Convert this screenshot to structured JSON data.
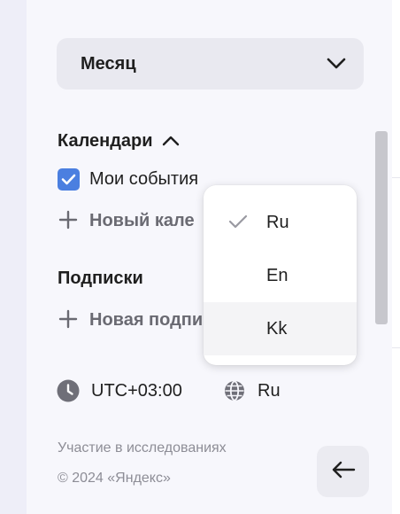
{
  "view_selector": {
    "selected": "Месяц"
  },
  "calendars": {
    "title": "Календари",
    "items": [
      {
        "label": "Мои события",
        "checked": true
      }
    ],
    "new_label": "Новый кале"
  },
  "subscriptions": {
    "title": "Подписки",
    "new_label": "Новая подпи"
  },
  "footer": {
    "timezone": "UTC+03:00",
    "language": "Ru",
    "research_link": "Участие в исследованиях",
    "copyright": "© 2024 «Яндекс»"
  },
  "language_menu": {
    "options": [
      {
        "label": "Ru",
        "selected": true
      },
      {
        "label": "En",
        "selected": false
      },
      {
        "label": "Kk",
        "selected": false,
        "hovered": true
      }
    ]
  },
  "colors": {
    "accent_blue": "#4b7fe0",
    "panel_bg": "#f7f7fc",
    "select_bg": "#e9e9f0",
    "muted_text": "#6a6a72"
  }
}
